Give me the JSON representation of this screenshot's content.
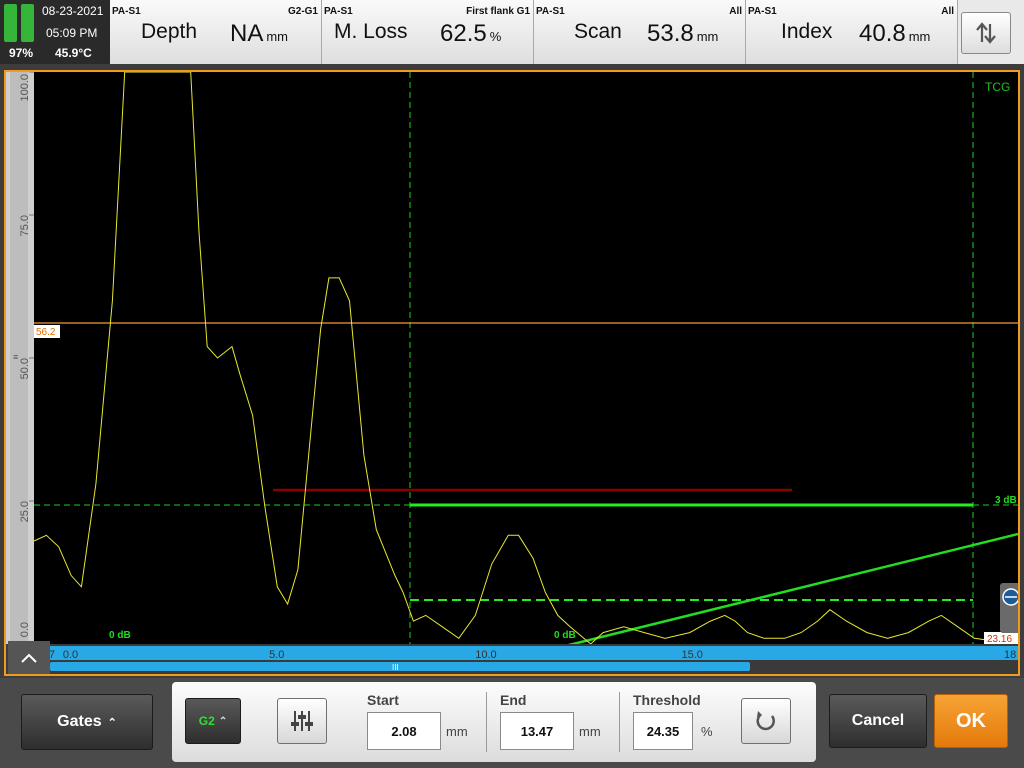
{
  "status": {
    "date": "08-23-2021",
    "time": "05:09 PM",
    "battery": "97%",
    "temperature": "45.9°C"
  },
  "readouts": [
    {
      "source": "PA-S1",
      "gate": "G2-G1",
      "name": "Depth",
      "value": "NA",
      "unit": "mm"
    },
    {
      "source": "PA-S1",
      "gate": "First flank G1",
      "name": "M. Loss",
      "value": "62.5",
      "unit": "%"
    },
    {
      "source": "PA-S1",
      "gate": "All",
      "name": "Scan",
      "value": "53.8",
      "unit": "mm"
    },
    {
      "source": "PA-S1",
      "gate": "All",
      "name": "Index",
      "value": "40.8",
      "unit": "mm"
    }
  ],
  "swap_icon": "swap-vertical-icon",
  "ascan": {
    "tcg_label": "TCG",
    "y_ticks": [
      "100.0",
      "75.0",
      "50.0",
      "25.0",
      "0.0"
    ],
    "x_ticks": [
      "-0.7",
      "0.0",
      "5.0",
      "10.0",
      "15.0",
      "18"
    ],
    "cursor_label": "56.2",
    "right_value": "23.16",
    "db_left": "0 dB",
    "db_mid": "0 dB",
    "db_right": "3 dB",
    "colors": {
      "signal": "#e8e830",
      "gate_green": "#22dd22",
      "cursor": "#f49a3c",
      "dark_red_gate": "#8b0000",
      "scale_blue": "#29a8e6"
    },
    "signal_points": [
      [
        -0.7,
        18
      ],
      [
        -0.4,
        19
      ],
      [
        -0.1,
        17
      ],
      [
        0.2,
        12
      ],
      [
        0.45,
        10
      ],
      [
        0.8,
        28
      ],
      [
        1.2,
        60
      ],
      [
        1.5,
        100
      ],
      [
        3.1,
        100
      ],
      [
        3.3,
        72
      ],
      [
        3.5,
        52
      ],
      [
        3.75,
        50
      ],
      [
        4.1,
        52
      ],
      [
        4.3,
        47
      ],
      [
        4.6,
        40
      ],
      [
        4.9,
        24
      ],
      [
        5.2,
        10
      ],
      [
        5.45,
        7
      ],
      [
        5.7,
        13
      ],
      [
        6.05,
        40
      ],
      [
        6.25,
        55
      ],
      [
        6.45,
        64
      ],
      [
        6.7,
        64
      ],
      [
        6.95,
        60
      ],
      [
        7.3,
        33
      ],
      [
        7.6,
        20
      ],
      [
        8.05,
        12
      ],
      [
        8.25,
        9
      ],
      [
        8.5,
        4
      ],
      [
        8.8,
        5
      ],
      [
        9.2,
        3
      ],
      [
        9.6,
        1
      ],
      [
        10.0,
        5
      ],
      [
        10.4,
        14
      ],
      [
        10.8,
        19
      ],
      [
        11.05,
        19
      ],
      [
        11.4,
        15
      ],
      [
        11.7,
        9
      ],
      [
        12.0,
        5
      ],
      [
        12.3,
        3
      ],
      [
        12.8,
        0
      ],
      [
        13.1,
        2
      ],
      [
        13.6,
        3
      ],
      [
        14.1,
        2
      ],
      [
        14.6,
        1
      ],
      [
        15.2,
        2
      ],
      [
        15.7,
        4
      ],
      [
        16.05,
        5
      ],
      [
        16.3,
        4
      ],
      [
        16.6,
        2
      ],
      [
        17.0,
        1
      ],
      [
        17.5,
        1
      ],
      [
        17.9,
        2
      ],
      [
        18.3,
        4
      ],
      [
        18.6,
        6
      ],
      [
        19.0,
        4
      ],
      [
        19.5,
        2
      ],
      [
        20.0,
        1
      ],
      [
        20.5,
        2
      ],
      [
        21.0,
        4
      ],
      [
        21.3,
        5
      ],
      [
        21.7,
        3
      ],
      [
        22.1,
        1
      ],
      [
        22.6,
        0.5
      ],
      [
        23.1,
        0.3
      ]
    ]
  },
  "bottom": {
    "gates_label": "Gates",
    "gate_selector": "G2",
    "start_label": "Start",
    "start_value": "2.08",
    "start_unit": "mm",
    "end_label": "End",
    "end_value": "13.47",
    "end_unit": "mm",
    "threshold_label": "Threshold",
    "threshold_value": "24.35",
    "threshold_unit": "%",
    "cancel_label": "Cancel",
    "ok_label": "OK",
    "scroll_handle": "III"
  }
}
